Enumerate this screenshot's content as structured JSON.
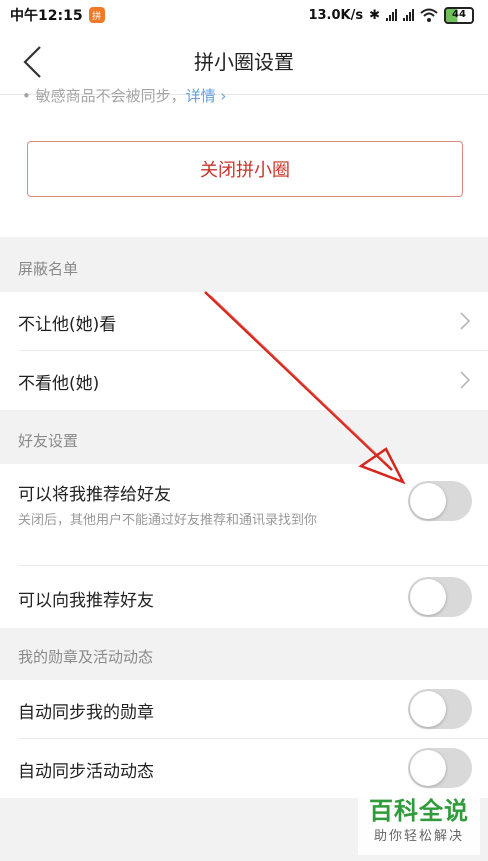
{
  "status_bar": {
    "time": "中午12:15",
    "app_badge": "拼",
    "net_speed": "13.0K/s",
    "battery": "44"
  },
  "nav": {
    "title": "拼小圈设置"
  },
  "top": {
    "sensitive_text": "• 敏感商品不会被同步，",
    "sensitive_link": "详情 ›",
    "close_button": "关闭拼小圈"
  },
  "sections": {
    "block_list": {
      "header": "屏蔽名单",
      "items": [
        "不让他(她)看",
        "不看他(她)"
      ]
    },
    "friend_settings": {
      "header": "好友设置",
      "recommend_me": {
        "label": "可以将我推荐给好友",
        "desc": "关闭后，其他用户不能通过好友推荐和通讯录找到你",
        "enabled": false
      },
      "recommend_to_me": {
        "label": "可以向我推荐好友",
        "enabled": false
      }
    },
    "badges": {
      "header": "我的勋章及活动动态",
      "sync_badges": {
        "label": "自动同步我的勋章",
        "enabled": false
      },
      "sync_activity": {
        "label": "自动同步活动动态",
        "enabled": false
      }
    }
  },
  "watermark": {
    "title": "百科全说",
    "subtitle": "助你轻松解决"
  },
  "colors": {
    "accent_red": "#c8352a",
    "toggle_off": "#d9d9d9",
    "watermark_green": "#2f9b3a"
  }
}
